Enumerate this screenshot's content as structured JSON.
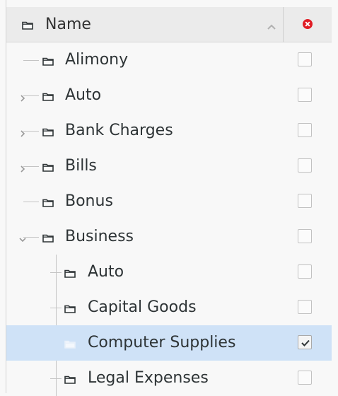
{
  "header": {
    "title": "Name",
    "folder_icon": "folder-icon",
    "sort_icon": "sort-ascending-icon",
    "clear_icon": "clear-selection-icon",
    "clear_color": "#e01b24"
  },
  "rows": [
    {
      "label": "Alimony",
      "level": 0,
      "expander": "none",
      "checked": false,
      "selected": false
    },
    {
      "label": "Auto",
      "level": 0,
      "expander": "collapsed",
      "checked": false,
      "selected": false
    },
    {
      "label": "Bank Charges",
      "level": 0,
      "expander": "collapsed",
      "checked": false,
      "selected": false
    },
    {
      "label": "Bills",
      "level": 0,
      "expander": "collapsed",
      "checked": false,
      "selected": false
    },
    {
      "label": "Bonus",
      "level": 0,
      "expander": "none",
      "checked": false,
      "selected": false
    },
    {
      "label": "Business",
      "level": 0,
      "expander": "expanded",
      "checked": false,
      "selected": false
    },
    {
      "label": "Auto",
      "level": 1,
      "expander": "none",
      "checked": false,
      "selected": false
    },
    {
      "label": "Capital Goods",
      "level": 1,
      "expander": "none",
      "checked": false,
      "selected": false
    },
    {
      "label": "Computer Supplies",
      "level": 1,
      "expander": "none",
      "checked": true,
      "selected": true
    },
    {
      "label": "Legal Expenses",
      "level": 1,
      "expander": "none",
      "checked": false,
      "selected": false
    }
  ],
  "colors": {
    "selection": "#cfe2f7",
    "tree_lines": "#c4c4c4",
    "text": "#2e3436"
  }
}
